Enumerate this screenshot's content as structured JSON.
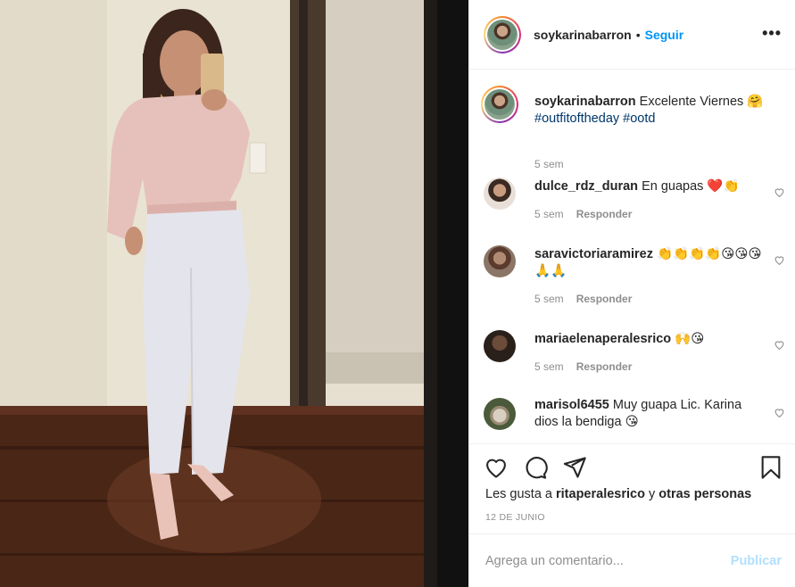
{
  "post": {
    "author": "soykarinabarron",
    "follow_label": "Seguir",
    "separator": "•",
    "more_icon": "ellipsis-icon",
    "caption": {
      "user": "soykarinabarron",
      "text": "Excelente Viernes 🤗",
      "hashtags": "#outfitoftheday #ootd",
      "time": "5 sem"
    },
    "comments": [
      {
        "user": "dulce_rdz_duran",
        "text": "En guapas ❤️👏",
        "time": "5 sem",
        "reply": "Responder"
      },
      {
        "user": "saravictoriaramirez",
        "text": "👏👏👏👏😘😘😘🙏🙏",
        "time": "5 sem",
        "reply": "Responder"
      },
      {
        "user": "mariaelenaperalesrico",
        "text": "🙌😘",
        "time": "5 sem",
        "reply": "Responder"
      },
      {
        "user": "marisol6455",
        "text": "Muy guapa Lic. Karina dios la bendiga 😘"
      }
    ],
    "likes": {
      "prefix": "Les gusta a",
      "first_user": "ritaperalesrico",
      "joiner": "y",
      "others": "otras personas"
    },
    "date": "12 DE JUNIO",
    "add_comment": {
      "placeholder": "Agrega un comentario...",
      "post_label": "Publicar"
    }
  },
  "colors": {
    "accent": "#0095f6",
    "hashtag": "#00376b",
    "muted": "#8e8e8e",
    "disabled_post": "#b2dffc"
  }
}
